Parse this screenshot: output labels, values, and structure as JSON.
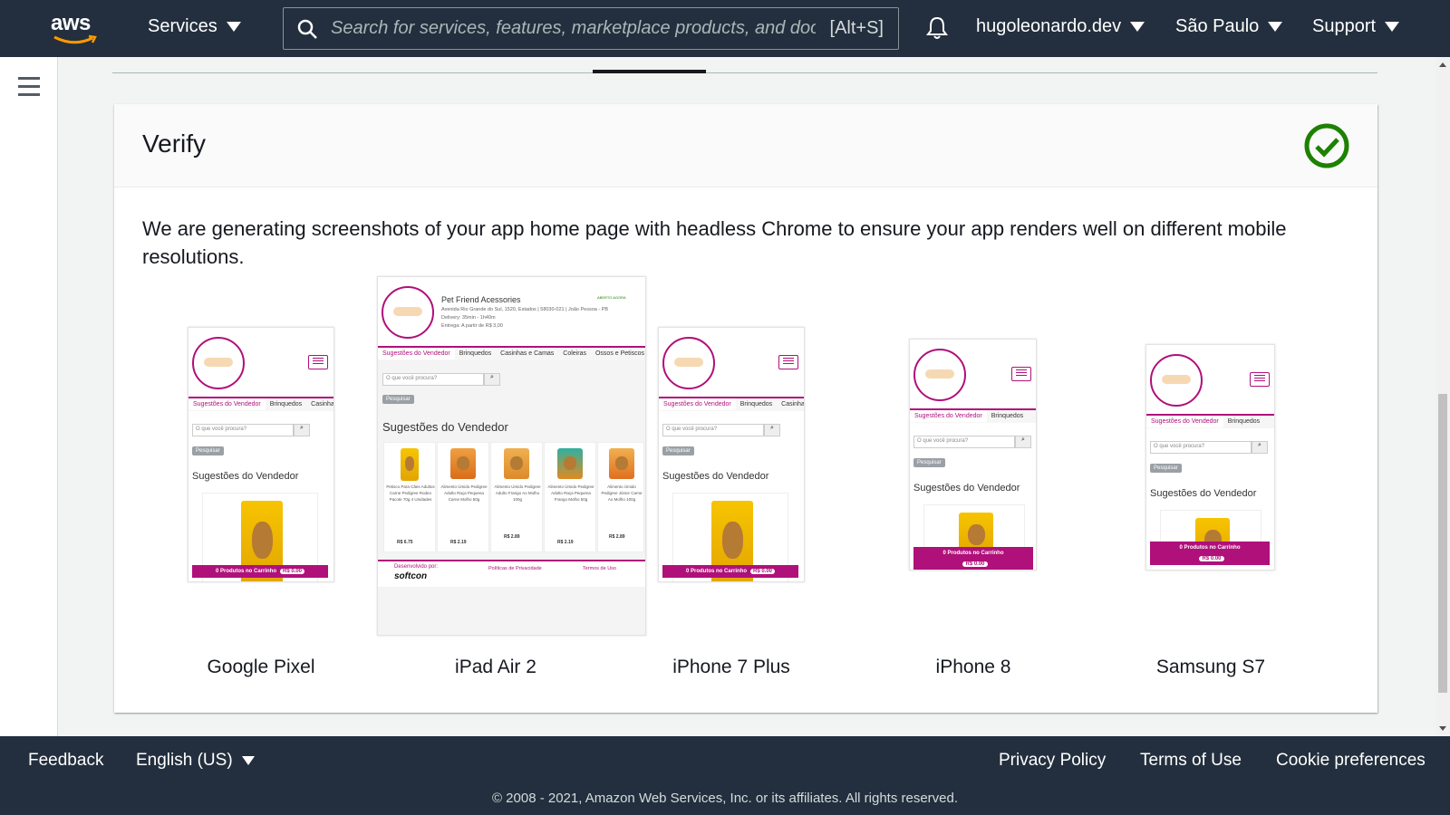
{
  "topnav": {
    "logo": "aws",
    "services_label": "Services",
    "search_placeholder": "Search for services, features, marketplace products, and docs",
    "search_shortcut": "[Alt+S]",
    "account_label": "hugoleonardo.dev",
    "region_label": "São Paulo",
    "support_label": "Support",
    "icons": [
      "search-icon",
      "bell-icon",
      "caret-down-icon"
    ]
  },
  "rail": {
    "menu_icon": "hamburger-icon"
  },
  "panel": {
    "title": "Verify",
    "status_icon": "check-circle-icon",
    "status_color": "#1d8102",
    "description": "We are generating screenshots of your app home page with headless Chrome to ensure your app renders well on different mobile resolutions."
  },
  "devices": [
    {
      "name": "Google Pixel"
    },
    {
      "name": "iPad Air 2"
    },
    {
      "name": "iPhone 7 Plus"
    },
    {
      "name": "iPhone 8"
    },
    {
      "name": "Samsung S7"
    }
  ],
  "app_preview": {
    "store_name": "Pet Friend Acessories",
    "address": "Avenida Rio Grande do Sul, 1520, Estados | 58030-021 | João Pessoa - PB",
    "delivery": "Delivery:  35min - 1h40m",
    "entrega": "Entrega:  A partir de R$ 3,00",
    "status_badge": "ABERTO AGORA",
    "tabs": [
      "Sugestões do Vendedor",
      "Brinquedos",
      "Casinhas e Camas",
      "Coleiras",
      "Ossos e Petiscos"
    ],
    "tab_short": "Casinha",
    "search_placeholder": "O que você procura?",
    "search_button": "Pesquisar",
    "section_title": "Sugestões do Vendedor",
    "cart_label": "0 Produtos no Carrinho",
    "cart_total": "R$ 0.00",
    "products": [
      {
        "name": "Petisco Para Cães Adultos Carne Pedigree Rodeo Pacote 70g 4 Unidades",
        "price": "R$ 6.75"
      },
      {
        "name": "Alimento Úmido Pedigree Adulto Raça Pequena Carne Molho 50g",
        "price": "R$ 2.19"
      },
      {
        "name": "Alimento Úmido Pedigree Adulto Frango Ao Molho 100g",
        "price": "R$ 2.89"
      },
      {
        "name": "Alimento Úmido Pedigree Adulto Raça Pequena Frango Molho 50g",
        "price": "R$ 2.19"
      },
      {
        "name": "Alimento Úmido Pedigree Júnior Carne Ao Molho 100g",
        "price": "R$ 2.89"
      }
    ],
    "footer_dev": "Desenvolvido por:",
    "footer_brand": "softcon",
    "footer_privacy": "Políticas de Privacidade",
    "footer_terms": "Termos de Uso"
  },
  "footer": {
    "feedback": "Feedback",
    "language": "English (US)",
    "privacy": "Privacy Policy",
    "terms": "Terms of Use",
    "cookies": "Cookie preferences",
    "copyright": "© 2008 - 2021, Amazon Web Services, Inc. or its affiliates. All rights reserved."
  }
}
